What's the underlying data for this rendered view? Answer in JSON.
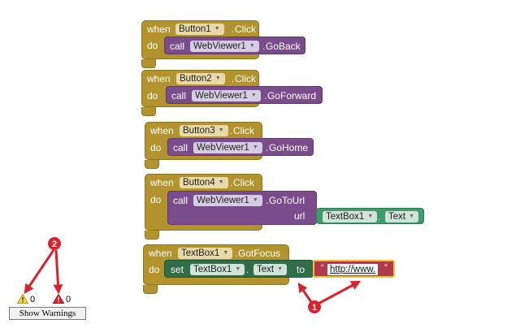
{
  "keywords": {
    "when": "when",
    "do": "do",
    "call": "call",
    "set": "set",
    "to": "to",
    "url": "url",
    "dot": "."
  },
  "blocks": [
    {
      "component": "Button1",
      "event": "Click",
      "target": "WebViewer1",
      "method": "GoBack"
    },
    {
      "component": "Button2",
      "event": "Click",
      "target": "WebViewer1",
      "method": "GoForward"
    },
    {
      "component": "Button3",
      "event": "Click",
      "target": "WebViewer1",
      "method": "GoHome"
    },
    {
      "component": "Button4",
      "event": "Click",
      "target": "WebViewer1",
      "method": "GoToUrl",
      "arg_component": "TextBox1",
      "arg_property": "Text"
    }
  ],
  "focus_block": {
    "component": "TextBox1",
    "event": "GotFocus",
    "set_component": "TextBox1",
    "set_property": "Text",
    "text_value": "http://www."
  },
  "callouts": {
    "one": "1",
    "two": "2",
    "color": "#D6252C"
  },
  "warnings": {
    "warning_count": "0",
    "error_count": "0",
    "button_label": "Show Warnings"
  },
  "colors": {
    "event": "#B2932E",
    "call": "#7A4C8C",
    "setter": "#2F6E49",
    "getter": "#3E9B6B",
    "text": "#B03A4B",
    "highlight": "#F2BE2E"
  }
}
